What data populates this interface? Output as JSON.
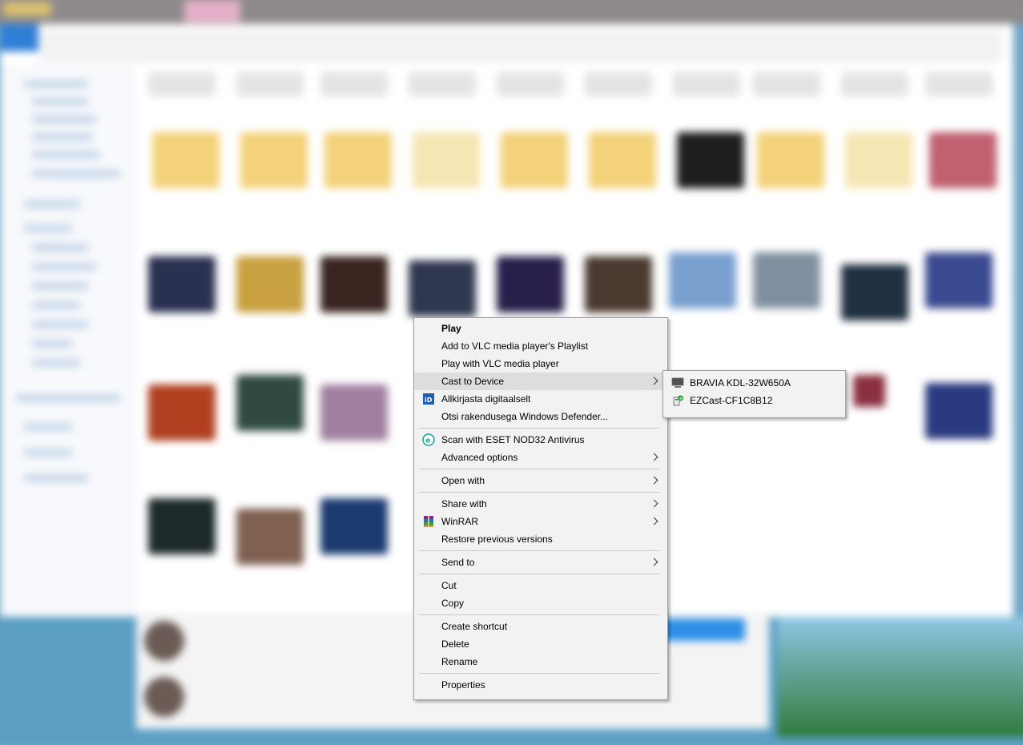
{
  "context_menu": {
    "items": [
      {
        "label": "Play"
      },
      {
        "label": "Add to VLC media player's Playlist"
      },
      {
        "label": "Play with VLC media player"
      },
      {
        "label": "Cast to Device"
      },
      {
        "label": "Allkirjasta digitaalselt",
        "icon": "digital-signature-icon"
      },
      {
        "label": "Otsi rakendusega Windows Defender..."
      },
      {
        "label": "Scan with ESET NOD32 Antivirus",
        "icon": "eset-icon"
      },
      {
        "label": "Advanced options"
      },
      {
        "label": "Open with"
      },
      {
        "label": "Share with"
      },
      {
        "label": "WinRAR",
        "icon": "winrar-icon"
      },
      {
        "label": "Restore previous versions"
      },
      {
        "label": "Send to"
      },
      {
        "label": "Cut"
      },
      {
        "label": "Copy"
      },
      {
        "label": "Create shortcut"
      },
      {
        "label": "Delete"
      },
      {
        "label": "Rename"
      },
      {
        "label": "Properties"
      }
    ]
  },
  "cast_submenu": {
    "devices": [
      {
        "label": "BRAVIA KDL-32W650A",
        "icon": "tv-icon"
      },
      {
        "label": "EZCast-CF1C8B12",
        "icon": "cast-device-icon"
      }
    ]
  },
  "colors": {
    "menu_bg": "#f2f2f2",
    "highlight": "#dddddd",
    "eset_accent": "#1aa39a",
    "signature_blue": "#1e5fb4"
  }
}
